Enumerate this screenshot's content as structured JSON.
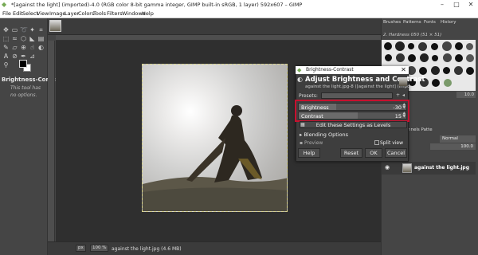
{
  "window": {
    "title": "*[against the light] (imported)-4.0 (RGB color 8-bit gamma integer, GIMP built-in sRGB, 1 layer) 592x607 – GIMP",
    "minimize": "–",
    "maximize": "□",
    "close": "✕"
  },
  "menu": [
    "File",
    "Edit",
    "Select",
    "View",
    "Image",
    "Layer",
    "Colors",
    "Tools",
    "Filters",
    "Windows",
    "Help"
  ],
  "toolbox": {
    "tools": [
      "move-tool-icon",
      "rect-select-icon",
      "lasso-icon",
      "fuzzy-select-icon",
      "crop-icon",
      "unified-transform-icon",
      "warp-icon",
      "cage-icon",
      "paint-bucket-icon",
      "gradient-icon",
      "paintbrush-icon",
      "eraser-icon",
      "clone-icon",
      "heal-icon",
      "smudge-icon",
      "dodge-icon",
      "path-icon",
      "text-icon",
      "color-picker-icon",
      "measure-icon",
      "zoom-icon"
    ],
    "options_title": "Brightness-Contrast",
    "options_note": "This tool has no options."
  },
  "dock": {
    "tabs": [
      "Brushes",
      "Patterns",
      "Fonts",
      "History"
    ],
    "brush_name": "2. Hardness 050 (51 × 51)",
    "spacing": "10.0",
    "layers_tabs": "nnels Patte",
    "mode": "Normal",
    "opacity": "100.0",
    "layer_name": "against the light.jpg"
  },
  "status": {
    "unit": "px",
    "zoom": "100 %",
    "file": "against the light.jpg (4.6 MB)"
  },
  "dialog": {
    "title": "Brightness-Contrast",
    "close": "✕",
    "heading": "Adjust Brightness and Contrast",
    "subtitle": "against the light.jpg-8 ([against the light] (impo...",
    "presets_label": "Presets:",
    "brightness": {
      "label": "Brightness",
      "value": "-30",
      "fraction": 0.35
    },
    "contrast": {
      "label": "Contrast",
      "value": "15",
      "fraction": 0.55
    },
    "edit_levels": "Edit these Settings as Levels",
    "blending": "Blending Options",
    "preview": "Preview",
    "split_view": "Split view",
    "buttons": {
      "help": "Help",
      "reset": "Reset",
      "ok": "OK",
      "cancel": "Cancel"
    },
    "highlight_color": "#c8102e"
  }
}
